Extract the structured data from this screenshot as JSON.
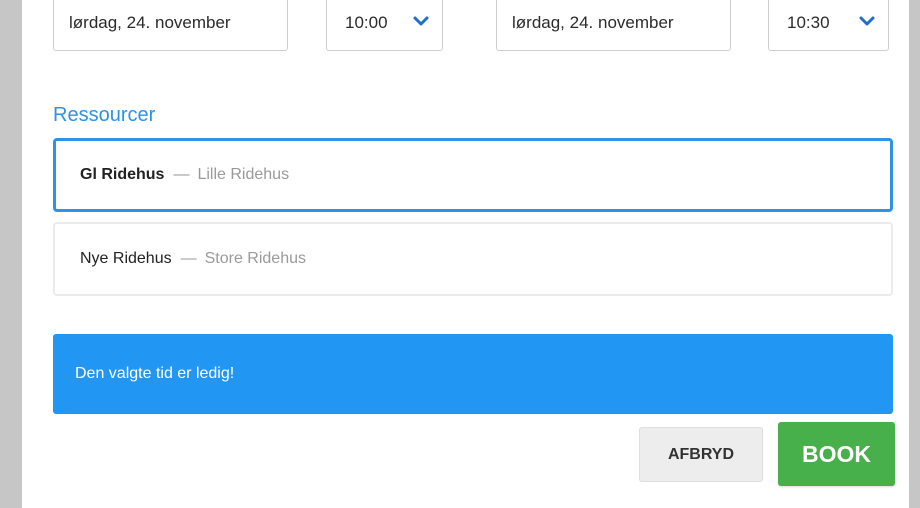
{
  "booking": {
    "start_date": "lørdag, 24. november",
    "start_time": "10:00",
    "end_date": "lørdag, 24. november",
    "end_time": "10:30"
  },
  "resources": {
    "title": "Ressourcer",
    "items": [
      {
        "name": "Gl Ridehus",
        "separator": "—",
        "sub": "Lille Ridehus",
        "selected": true
      },
      {
        "name": "Nye Ridehus",
        "separator": "—",
        "sub": "Store Ridehus",
        "selected": false
      }
    ]
  },
  "status": {
    "message": "Den valgte tid er ledig!",
    "color": "#2196f3"
  },
  "actions": {
    "cancel_label": "AFBRYD",
    "book_label": "BOOK",
    "book_color": "#47b04b"
  },
  "theme": {
    "accent": "#2e92e6"
  }
}
